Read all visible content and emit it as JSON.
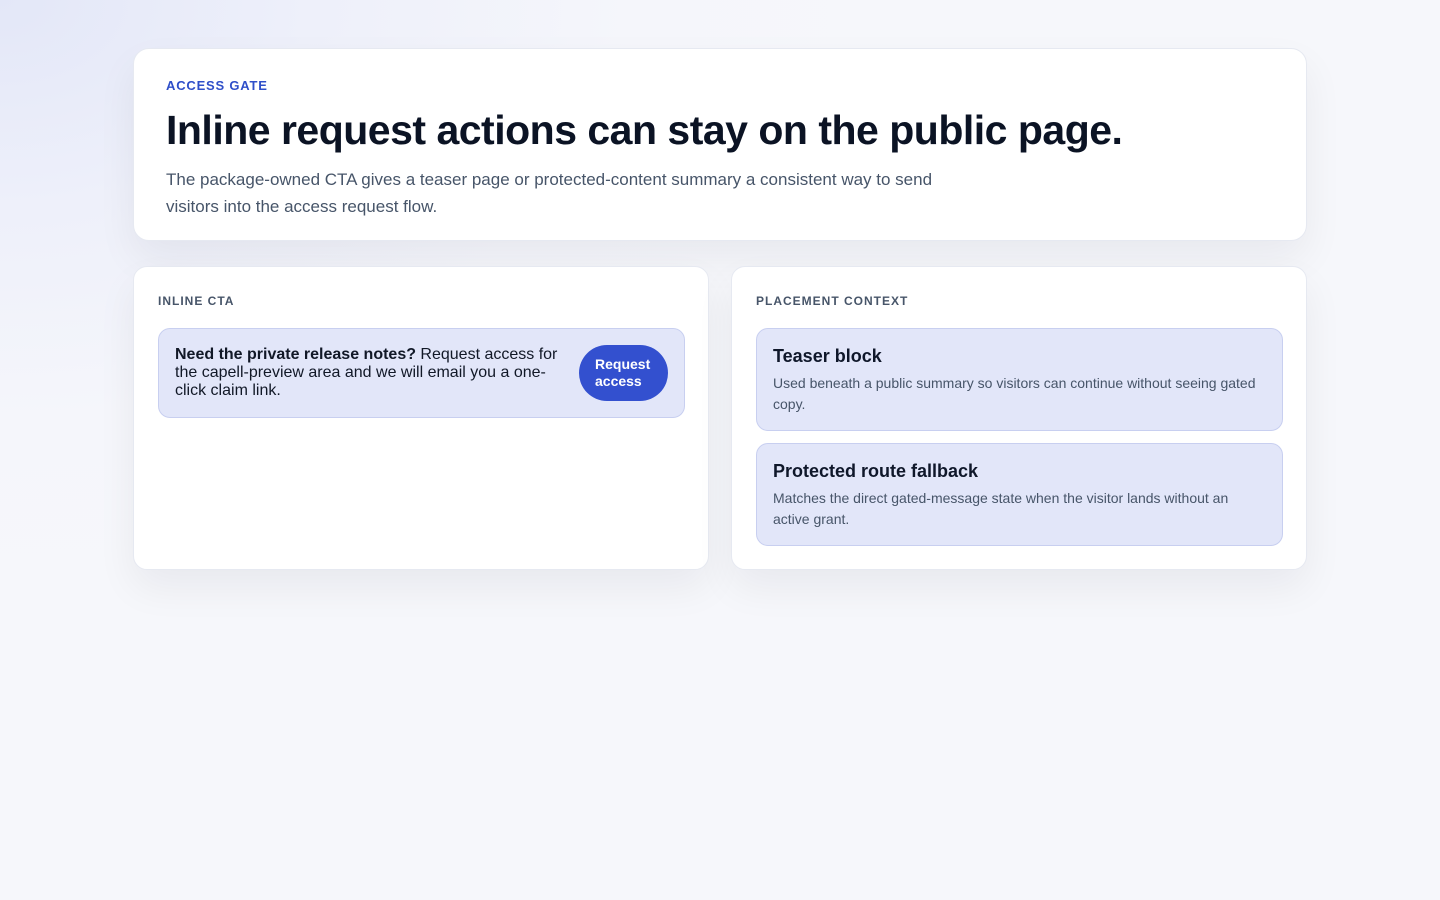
{
  "hero": {
    "eyebrow": "ACCESS GATE",
    "title": "Inline request actions can stay on the public page.",
    "description": "The package-owned CTA gives a teaser page or protected-content summary a consistent way to send visitors into the access request flow."
  },
  "inline_cta": {
    "heading": "INLINE CTA",
    "lead": "Need the private release notes?",
    "body": " Request access for the capell-preview area and we will email you a one-click claim link.",
    "button_label": "Request access"
  },
  "placement_context": {
    "heading": "PLACEMENT CONTEXT",
    "items": [
      {
        "title": "Teaser block",
        "description": "Used beneath a public summary so visitors can continue without seeing gated copy."
      },
      {
        "title": "Protected route fallback",
        "description": "Matches the direct gated-message state when the visitor lands without an active grant."
      }
    ]
  },
  "colors": {
    "accent": "#3350cf",
    "eyebrow": "#2f4fc9",
    "card_fill": "#e2e6f9"
  }
}
